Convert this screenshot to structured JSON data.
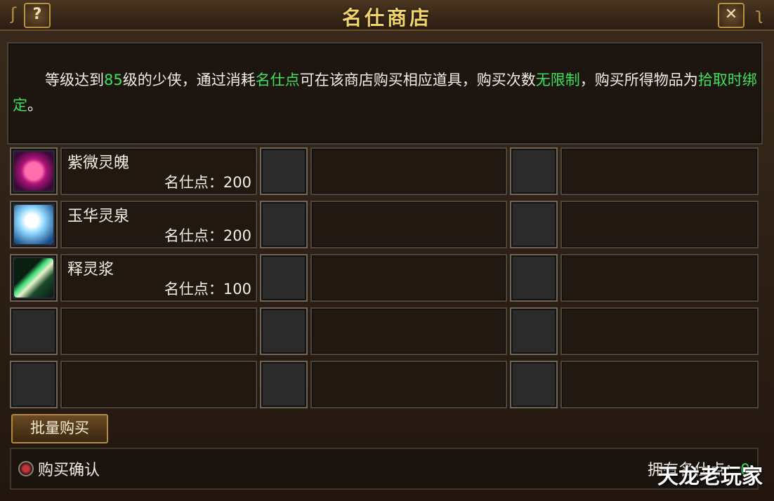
{
  "window": {
    "title": "名仕商店",
    "help_label": "?",
    "close_label": "✕"
  },
  "description": {
    "parts": [
      {
        "text": "等级达到",
        "highlight": false
      },
      {
        "text": "85",
        "highlight": true
      },
      {
        "text": "级的少侠，通过消耗",
        "highlight": false
      },
      {
        "text": "名仕点",
        "highlight": true
      },
      {
        "text": "可在该商店购买相应道具，购买次数",
        "highlight": false
      },
      {
        "text": "无限制",
        "highlight": true
      },
      {
        "text": "，购买所得物品为",
        "highlight": false
      },
      {
        "text": "拾取时绑定",
        "highlight": true
      },
      {
        "text": "。",
        "highlight": false
      }
    ]
  },
  "items": [
    {
      "name": "紫微灵魄",
      "price": "名仕点：200",
      "icon": "purple-heart-gem-icon"
    },
    {
      "name": "玉华灵泉",
      "price": "名仕点：200",
      "icon": "blue-spring-icon"
    },
    {
      "name": "释灵浆",
      "price": "名仕点：100",
      "icon": "green-wand-icon"
    },
    {
      "name": "",
      "price": "",
      "icon": ""
    },
    {
      "name": "",
      "price": "",
      "icon": ""
    },
    {
      "name": "",
      "price": "",
      "icon": ""
    },
    {
      "name": "",
      "price": "",
      "icon": ""
    },
    {
      "name": "",
      "price": "",
      "icon": ""
    },
    {
      "name": "",
      "price": "",
      "icon": ""
    },
    {
      "name": "",
      "price": "",
      "icon": ""
    },
    {
      "name": "",
      "price": "",
      "icon": ""
    },
    {
      "name": "",
      "price": "",
      "icon": ""
    },
    {
      "name": "",
      "price": "",
      "icon": ""
    },
    {
      "name": "",
      "price": "",
      "icon": ""
    },
    {
      "name": "",
      "price": "",
      "icon": ""
    }
  ],
  "buttons": {
    "batch_buy": "批量购买"
  },
  "footer": {
    "confirm_label": "购买确认",
    "owned_label": "拥有名仕点：",
    "owned_value": "0"
  },
  "watermark": "天龙老玩家",
  "colors": {
    "highlight": "#3fe05a",
    "title": "#f2d46a"
  }
}
